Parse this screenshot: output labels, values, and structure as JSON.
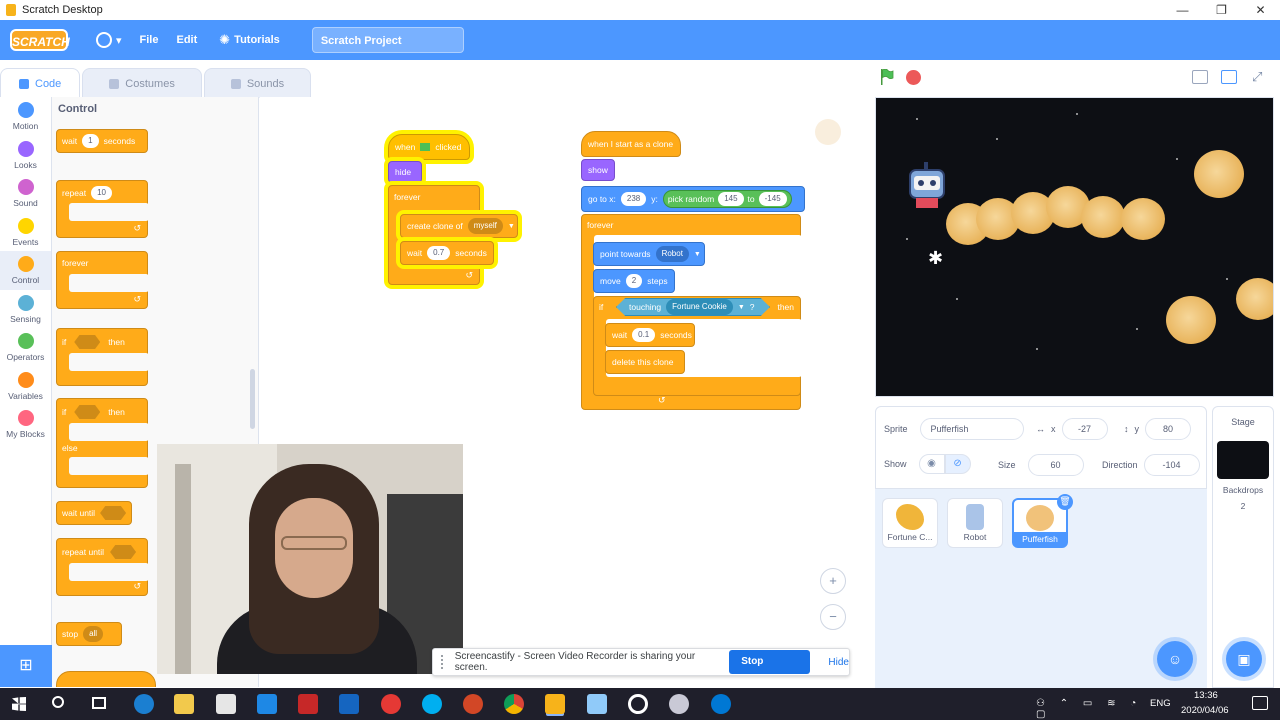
{
  "window": {
    "title": "Scratch Desktop",
    "minimize": "—",
    "maximize": "❐",
    "close": "✕"
  },
  "menubar": {
    "logo": "SCRATCH",
    "file": "File",
    "edit": "Edit",
    "tutorials": "Tutorials",
    "project_title": "Scratch Project",
    "globe_caret": "▾"
  },
  "tabs": {
    "code": "Code",
    "costumes": "Costumes",
    "sounds": "Sounds"
  },
  "categories": [
    {
      "label": "Motion",
      "color": "#4c97ff"
    },
    {
      "label": "Looks",
      "color": "#9966ff"
    },
    {
      "label": "Sound",
      "color": "#cf63cf"
    },
    {
      "label": "Events",
      "color": "#ffd500"
    },
    {
      "label": "Control",
      "color": "#ffab19"
    },
    {
      "label": "Sensing",
      "color": "#5cb1d6"
    },
    {
      "label": "Operators",
      "color": "#59c059"
    },
    {
      "label": "Variables",
      "color": "#ff8c1a"
    },
    {
      "label": "My Blocks",
      "color": "#ff6680"
    }
  ],
  "palette": {
    "title": "Control",
    "wait": "wait",
    "wait_value": "1",
    "wait_unit": "seconds",
    "repeat": "repeat",
    "repeat_value": "10",
    "forever": "forever",
    "if": "if",
    "then": "then",
    "if2": "if",
    "then2": "then",
    "else": "else",
    "wait_until": "wait until",
    "repeat_until": "repeat until",
    "stop": "stop",
    "stop_value": "all"
  },
  "script1": {
    "when": "when",
    "clicked": "clicked",
    "hide": "hide",
    "forever": "forever",
    "create_clone": "create clone of",
    "clone_target": "myself",
    "wait": "wait",
    "wait_value": "0.7",
    "wait_unit": "seconds"
  },
  "script2": {
    "hat": "when I start as a clone",
    "show": "show",
    "goto": "go to x:",
    "x_value": "238",
    "y_label": "y:",
    "pick_random": "pick random",
    "rand_from": "145",
    "to": "to",
    "rand_to": "-145",
    "forever": "forever",
    "point_towards": "point towards",
    "point_target": "Robot",
    "move": "move",
    "move_value": "2",
    "steps": "steps",
    "if": "if",
    "touching": "touching",
    "touching_target": "Fortune Cookie",
    "question": "?",
    "then": "then",
    "wait": "wait",
    "wait_value": "0.1",
    "wait_unit": "seconds",
    "delete_clone": "delete this clone"
  },
  "zoom": {
    "zoom_in": "+",
    "zoom_out": "−"
  },
  "sprite_info": {
    "sprite_label": "Sprite",
    "sprite_name": "Pufferfish",
    "x_icon": "↔",
    "x_label": "x",
    "x_value": "-27",
    "y_icon": "↕",
    "y_label": "y",
    "y_value": "80",
    "show_label": "Show",
    "show_icon": "◉",
    "hide_icon": "⊘",
    "size_label": "Size",
    "size_value": "60",
    "direction_label": "Direction",
    "direction_value": "-104"
  },
  "sprites": [
    {
      "name": "Fortune C..."
    },
    {
      "name": "Robot"
    },
    {
      "name": "Pufferfish"
    }
  ],
  "delete_icon": "🗑",
  "stage_panel": {
    "title": "Stage",
    "backdrops_label": "Backdrops",
    "backdrops_count": "2"
  },
  "sharebar": {
    "message": "Screencastify - Screen Video Recorder is sharing your screen.",
    "stop": "Stop sharing",
    "hide": "Hide"
  },
  "taskbar": {
    "language": "ENG",
    "time": "13:36",
    "date": "2020/04/06"
  },
  "colors": {
    "scratch_blue": "#4c97ff",
    "control": "#ffab19",
    "events": "#ffbf00",
    "looks": "#9966ff",
    "motion": "#4c97ff",
    "sensing": "#5cb1d6"
  }
}
